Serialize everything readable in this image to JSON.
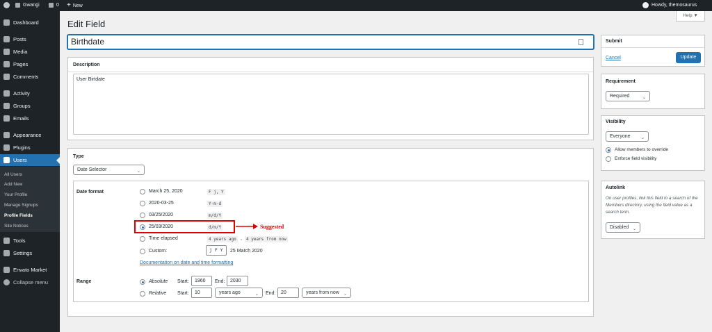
{
  "admin_bar": {
    "site_name": "Gwangi",
    "comments_count": "0",
    "new_label": "New",
    "howdy": "Howdy, themosaurus"
  },
  "sidebar": {
    "items": [
      {
        "label": "Dashboard",
        "icon": "dashboard-icon"
      },
      {
        "label": "Posts",
        "icon": "pin-icon"
      },
      {
        "label": "Media",
        "icon": "media-icon"
      },
      {
        "label": "Pages",
        "icon": "pages-icon"
      },
      {
        "label": "Comments",
        "icon": "comment-icon"
      },
      {
        "label": "Activity",
        "icon": "activity-icon"
      },
      {
        "label": "Groups",
        "icon": "groups-icon"
      },
      {
        "label": "Emails",
        "icon": "email-icon"
      },
      {
        "label": "Appearance",
        "icon": "brush-icon"
      },
      {
        "label": "Plugins",
        "icon": "plugin-icon"
      },
      {
        "label": "Users",
        "icon": "users-icon"
      },
      {
        "label": "Tools",
        "icon": "wrench-icon"
      },
      {
        "label": "Settings",
        "icon": "settings-icon"
      },
      {
        "label": "Envato Market",
        "icon": "leaf-icon"
      },
      {
        "label": "Collapse menu",
        "icon": "collapse-icon"
      }
    ],
    "users_submenu": [
      "All Users",
      "Add New",
      "Your Profile",
      "Manage Signups",
      "Profile Fields",
      "Site Notices"
    ]
  },
  "page": {
    "title": "Edit Field",
    "help_label": "Help ▼",
    "field_name": "Birthdate",
    "description_label": "Description",
    "description_value": "User Birtdate",
    "type_label": "Type",
    "type_value": "Date Selector",
    "date_format_label": "Date format",
    "date_formats": [
      {
        "label": "March 25, 2020",
        "code": "F j, Y"
      },
      {
        "label": "2020-03-25",
        "code": "Y-m-d"
      },
      {
        "label": "03/25/2020",
        "code": "m/d/Y"
      },
      {
        "label": "25/03/2020",
        "code": "d/m/Y"
      },
      {
        "label": "Time elapsed",
        "code": "4 years ago",
        "code2": "4 years from now"
      },
      {
        "label": "Custom:",
        "code": "j F Y",
        "preview": "25 March 2020"
      }
    ],
    "doc_link": "Documentation on date and time formatting",
    "suggested_label": "Suggested",
    "range": {
      "label": "Range",
      "absolute_label": "Absolute",
      "relative_label": "Relative",
      "start_label": "Start:",
      "end_label": "End:",
      "abs_start": "1960",
      "abs_end": "2030",
      "rel_start": "10",
      "rel_start_unit": "years ago",
      "rel_end": "20",
      "rel_end_unit": "years from now"
    }
  },
  "side_panels": {
    "submit_title": "Submit",
    "cancel_label": "Cancel",
    "update_label": "Update",
    "requirement_title": "Requirement",
    "requirement_value": "Required",
    "visibility_title": "Visibility",
    "visibility_value": "Everyone",
    "allow_override": "Allow members to override",
    "enforce_visibility": "Enforce field visibility",
    "autolink_title": "Autolink",
    "autolink_desc": "On user profiles, link this field to a search of the Members directory, using the field value as a search term.",
    "autolink_value": "Disabled"
  },
  "colors": {
    "accent": "#2271b1",
    "admin_dark": "#1d2327",
    "highlight_red": "#e00000"
  }
}
